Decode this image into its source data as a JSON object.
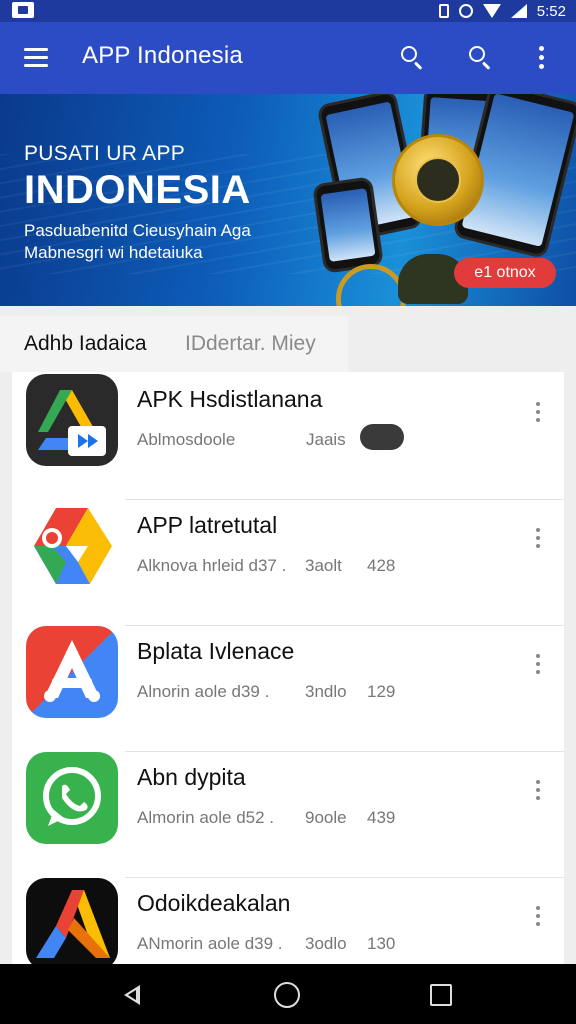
{
  "status_bar": {
    "time": "5:52"
  },
  "app_bar": {
    "title": "APP Indonesia"
  },
  "banner": {
    "line1": "PUSATI UR APP",
    "line2": "INDONESIA",
    "line3": "Pasduabenitd Cieusyhain Aga Mabnesgri wi hdetaiuka",
    "promo_label": "e1 otnox"
  },
  "filters": {
    "active": "Adhb Iadaica",
    "inactive": "IDdertar. Miey"
  },
  "apps": [
    {
      "name": "APK Hsdistlanana",
      "meta": "Ablmosdoole",
      "downloads": "Jaais",
      "size": "",
      "icon": "drive-play-icon",
      "has_toggle": true
    },
    {
      "name": "APP latretutal",
      "meta": "Alknova hrleid d37 .",
      "downloads": "3aolt",
      "size": "428",
      "icon": "chrome-drive-icon",
      "has_toggle": false
    },
    {
      "name": "Bplata Ivlenace",
      "meta": "Alnorin aole d39 .",
      "downloads": "3ndlo",
      "size": "129",
      "icon": "app-store-a-icon",
      "has_toggle": false
    },
    {
      "name": "Abn dypita",
      "meta": "Almorin aole d52 .",
      "downloads": "9oole",
      "size": "439",
      "icon": "whatsapp-icon",
      "has_toggle": false
    },
    {
      "name": "Odoikdeakalan",
      "meta": "ANmorin aole d39 .",
      "downloads": "3odlo",
      "size": "130",
      "icon": "play-arrow-icon",
      "has_toggle": false
    }
  ]
}
